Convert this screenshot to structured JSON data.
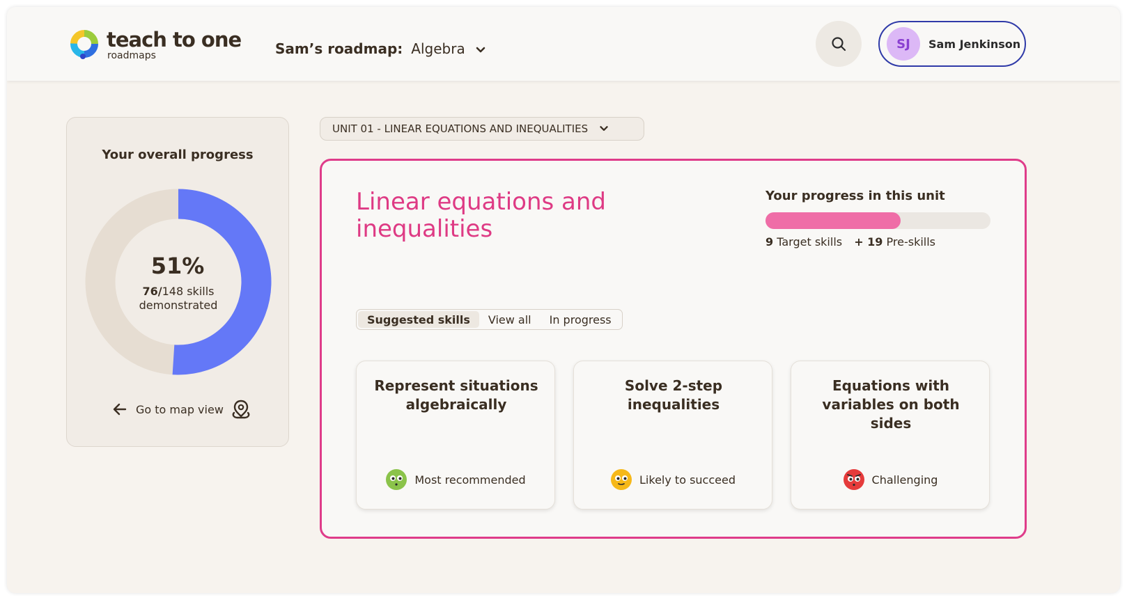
{
  "header": {
    "logo_main": "teach to one",
    "logo_sub": "roadmaps",
    "roadmap_label": "Sam’s roadmap:",
    "roadmap_subject": "Algebra",
    "user_initials": "SJ",
    "user_name": "Sam Jenkinson"
  },
  "overall": {
    "title": "Your overall progress",
    "percent_label": "51%",
    "percent": 51,
    "demonstrated": "76/",
    "total": "148 skills",
    "demonstrated_label": "demonstrated",
    "map_link": "Go to map view"
  },
  "unit": {
    "selector": "UNIT 01 - LINEAR EQUATIONS AND INEQUALITIES",
    "title": "Linear equations and inequalities",
    "progress_title": "Your progress in this unit",
    "progress_fraction": 0.6,
    "target_count": "9",
    "target_label": "Target skills",
    "pre_count": "+ 19",
    "pre_label": "Pre-skills"
  },
  "tabs": [
    {
      "label": "Suggested skills",
      "active": true
    },
    {
      "label": "View all",
      "active": false
    },
    {
      "label": "In progress",
      "active": false
    }
  ],
  "skills": [
    {
      "title": "Represent situations algebraically",
      "tag": "Most recommended",
      "face": "green-face-icon",
      "color": "#8bc34a"
    },
    {
      "title": "Solve 2-step inequalities",
      "tag": "Likely to succeed",
      "face": "yellow-face-icon",
      "color": "#f6b819"
    },
    {
      "title": "Equations with variables on both sides",
      "tag": "Challenging",
      "face": "red-face-icon",
      "color": "#e53b3b"
    }
  ],
  "colors": {
    "donut_fill": "#6478f7",
    "donut_track": "#e6ddd2",
    "accent_pink": "#df3c8a",
    "bar_fill": "#ef6da7"
  }
}
